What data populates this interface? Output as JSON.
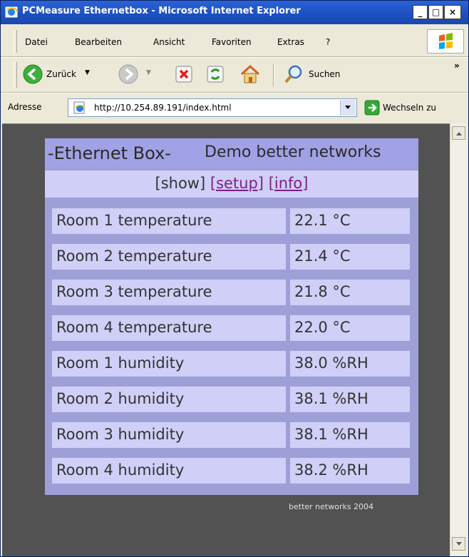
{
  "window": {
    "title": "PCMeasure Ethernetbox - Microsoft Internet Explorer",
    "minimize": "_",
    "maximize": "□",
    "close": "×"
  },
  "menu": {
    "items": [
      "Datei",
      "Bearbeiten",
      "Ansicht",
      "Favoriten",
      "Extras",
      "?"
    ]
  },
  "toolbar": {
    "back_label": "Zurück",
    "search_label": "Suchen",
    "overflow": "»"
  },
  "address": {
    "label": "Adresse",
    "url": "http://10.254.89.191/index.html",
    "go_label": "Wechseln zu"
  },
  "page": {
    "brand": "-Ethernet Box-",
    "subtitle": "Demo better networks",
    "nav": {
      "show": "[show]",
      "setup": "[setup]",
      "info": "[info]"
    },
    "readings": [
      {
        "name": "Room 1 temperature",
        "value": "22.1 °C"
      },
      {
        "name": "Room 2 temperature",
        "value": "21.4 °C"
      },
      {
        "name": "Room 3 temperature",
        "value": "21.8 °C"
      },
      {
        "name": "Room 4 temperature",
        "value": "22.0 °C"
      },
      {
        "name": "Room 1 humidity",
        "value": "38.0 %RH"
      },
      {
        "name": "Room 2 humidity",
        "value": "38.1 %RH"
      },
      {
        "name": "Room 3 humidity",
        "value": "38.1 %RH"
      },
      {
        "name": "Room 4 humidity",
        "value": "38.2 %RH"
      }
    ],
    "footer": "better networks 2004"
  },
  "colors": {
    "page_background": "#525252",
    "panel": "#9f9fd8",
    "cell": "#cfcff7",
    "link": "#7f1f86"
  }
}
